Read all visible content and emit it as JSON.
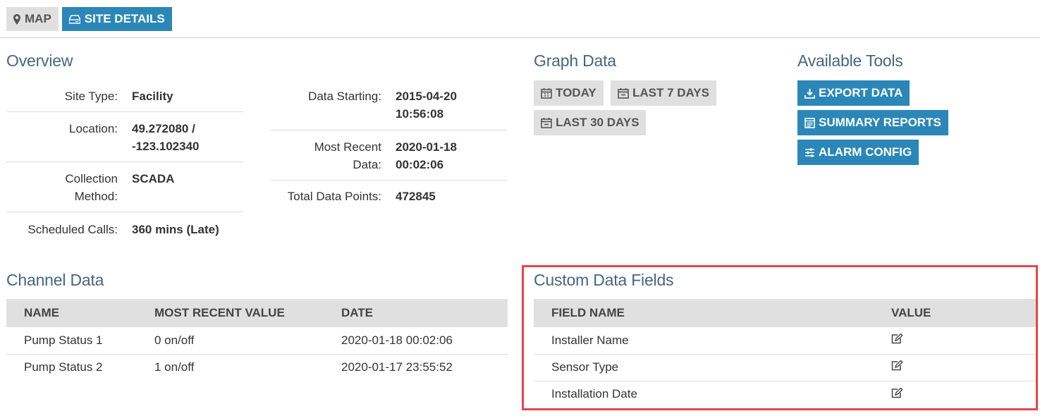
{
  "tabs": {
    "map_label": "MAP",
    "site_details_label": "SITE DETAILS"
  },
  "overview": {
    "title": "Overview",
    "left": [
      {
        "label": "Site Type:",
        "value": "Facility"
      },
      {
        "label": "Location:",
        "value_line1": "49.272080 /",
        "value_line2": "-123.102340"
      },
      {
        "label_line1": "Collection",
        "label_line2": "Method:",
        "value": "SCADA"
      },
      {
        "label": "Scheduled Calls:",
        "value": "360 mins (Late)"
      }
    ],
    "right": [
      {
        "label": "Data Starting:",
        "value_line1": "2015-04-20",
        "value_line2": "10:56:08"
      },
      {
        "label_line1": "Most Recent",
        "label_line2": "Data:",
        "value_line1": "2020-01-18",
        "value_line2": "00:02:06"
      },
      {
        "label": "Total Data Points:",
        "value": "472845"
      }
    ]
  },
  "graph_data": {
    "title": "Graph Data",
    "today_label": "TODAY",
    "last7_label": "LAST 7 DAYS",
    "last30_label": "LAST 30 DAYS"
  },
  "tools": {
    "title": "Available Tools",
    "export_label": "EXPORT DATA",
    "summary_label": "SUMMARY REPORTS",
    "alarm_label": "ALARM CONFIG"
  },
  "channel_data": {
    "title": "Channel Data",
    "headers": [
      "NAME",
      "MOST RECENT VALUE",
      "DATE"
    ],
    "rows": [
      [
        "Pump Status 1",
        "0 on/off",
        "2020-01-18 00:02:06"
      ],
      [
        "Pump Status 2",
        "1 on/off",
        "2020-01-17 23:55:52"
      ]
    ]
  },
  "custom_fields": {
    "title": "Custom Data Fields",
    "headers": [
      "FIELD NAME",
      "VALUE"
    ],
    "rows": [
      {
        "field": "Installer Name"
      },
      {
        "field": "Sensor Type"
      },
      {
        "field": "Installation Date"
      }
    ]
  },
  "colors": {
    "primary_button": "#2a87b8",
    "secondary_button": "#e0e0e0",
    "heading": "#45667f",
    "highlight_border": "#e8444e"
  }
}
